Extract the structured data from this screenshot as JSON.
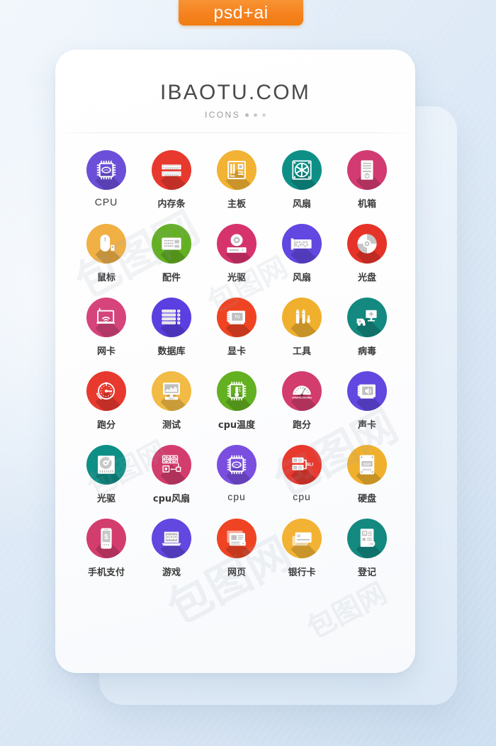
{
  "badge": {
    "label": "psd+ai",
    "color": "#f5821f"
  },
  "header": {
    "title": "IBAOTU.COM",
    "subtitle": "ICONS",
    "dots": 3
  },
  "watermark": {
    "text": "包图网"
  },
  "theme": {
    "page_background": "#dfe9f5",
    "card_background": "#ffffff",
    "label_color": "#3a3a3a",
    "title_color": "#4a4a4a",
    "subtitle_color": "#9a9a9a"
  },
  "grid": {
    "columns": 5,
    "rows": 6,
    "icons": [
      {
        "label": "CPU",
        "latin": true,
        "color": "#6c4fd8",
        "icon": "cpu-chip-icon"
      },
      {
        "label": "内存条",
        "latin": false,
        "color": "#e8392e",
        "icon": "ram-memory-icon"
      },
      {
        "label": "主板",
        "latin": false,
        "color": "#f2b233",
        "icon": "motherboard-icon"
      },
      {
        "label": "风扇",
        "latin": false,
        "color": "#0e8f86",
        "icon": "case-fan-icon"
      },
      {
        "label": "机箱",
        "latin": false,
        "color": "#d23b72",
        "icon": "computer-case-icon"
      },
      {
        "label": "鼠标",
        "latin": false,
        "color": "#f0b044",
        "icon": "mouse-icon"
      },
      {
        "label": "配件",
        "latin": false,
        "color": "#63b021",
        "icon": "accessories-icon"
      },
      {
        "label": "光驱",
        "latin": false,
        "color": "#d6336d",
        "icon": "optical-drive-icon"
      },
      {
        "label": "风扇",
        "latin": false,
        "color": "#6247e0",
        "icon": "graphics-card-fan-icon"
      },
      {
        "label": "光盘",
        "latin": false,
        "color": "#e63329",
        "icon": "compact-disc-icon"
      },
      {
        "label": "网卡",
        "latin": false,
        "color": "#d6447c",
        "icon": "network-card-icon"
      },
      {
        "label": "数据库",
        "latin": false,
        "color": "#5b3fe0",
        "icon": "database-server-icon"
      },
      {
        "label": "显卡",
        "latin": false,
        "color": "#ef4423",
        "icon": "tv-tuner-card-icon"
      },
      {
        "label": "工具",
        "latin": false,
        "color": "#f0b02e",
        "icon": "tools-icon"
      },
      {
        "label": "病毒",
        "latin": false,
        "color": "#13897f",
        "icon": "virus-rescue-icon"
      },
      {
        "label": "跑分",
        "latin": false,
        "color": "#e8392e",
        "icon": "benchmark-gauge-icon"
      },
      {
        "label": "测试",
        "latin": false,
        "color": "#f2bb45",
        "icon": "test-monitor-icon"
      },
      {
        "label": "cpu温度",
        "latin": false,
        "color": "#63b021",
        "icon": "cpu-temperature-icon"
      },
      {
        "label": "跑分",
        "latin": false,
        "color": "#d33d6e",
        "icon": "overclocking-gauge-icon"
      },
      {
        "label": "声卡",
        "latin": false,
        "color": "#6247e0",
        "icon": "sound-card-icon"
      },
      {
        "label": "光驱",
        "latin": false,
        "color": "#0e8f86",
        "icon": "hard-disk-icon"
      },
      {
        "label": "cpu风扇",
        "latin": false,
        "color": "#d33d6e",
        "icon": "cpu-cooler-icon"
      },
      {
        "label": "cpu",
        "latin": true,
        "color": "#7a4fe0",
        "icon": "cpu-chip-icon"
      },
      {
        "label": "cpu",
        "latin": true,
        "color": "#e8392e",
        "icon": "sli-cpu-icon"
      },
      {
        "label": "硬盘",
        "latin": false,
        "color": "#f0b02e",
        "icon": "ssd-drive-icon"
      },
      {
        "label": "手机支付",
        "latin": false,
        "color": "#d33d6e",
        "icon": "mobile-payment-icon"
      },
      {
        "label": "游戏",
        "latin": false,
        "color": "#6247e0",
        "icon": "game-laptop-icon"
      },
      {
        "label": "网页",
        "latin": false,
        "color": "#ef4423",
        "icon": "webpage-lock-icon"
      },
      {
        "label": "银行卡",
        "latin": false,
        "color": "#f2b233",
        "icon": "bank-card-icon"
      },
      {
        "label": "登记",
        "latin": false,
        "color": "#13897f",
        "icon": "registration-document-icon"
      }
    ]
  }
}
